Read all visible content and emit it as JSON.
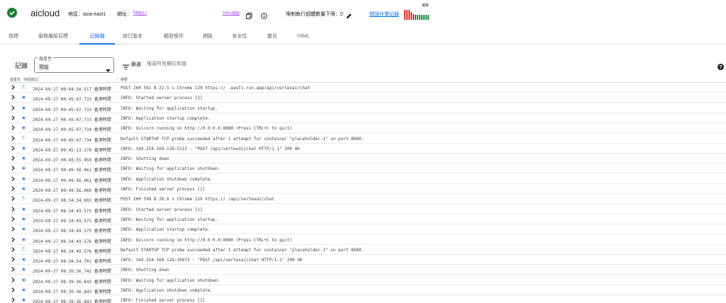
{
  "header": {
    "service_name": "aicloud",
    "region": "地區：asia-east1",
    "url_label": "網址：",
    "url": "https:/",
    "url_suffix": "run.app",
    "limit_label": "限制執行個體數量下限：0",
    "error_link": "錯誤作業記錄",
    "error_chart_label": "最新",
    "error_bars": [
      {
        "value": 1.0,
        "color": "#d93025"
      },
      {
        "value": 1.0,
        "color": "#d93025"
      },
      {
        "value": 1.0,
        "color": "#d93025"
      },
      {
        "value": 0.8,
        "color": "#d93025"
      },
      {
        "value": 0.6,
        "color": "#d93025"
      },
      {
        "value": 0.5,
        "color": "#1e8e3e"
      },
      {
        "value": 0.5,
        "color": "#1e8e3e"
      },
      {
        "value": 0.5,
        "color": "#1e8e3e"
      },
      {
        "value": 0.5,
        "color": "#1e8e3e"
      },
      {
        "value": 0.5,
        "color": "#1e8e3e"
      },
      {
        "value": 0.5,
        "color": "#1e8e3e"
      },
      {
        "value": 0.5,
        "color": "#1e8e3e"
      }
    ]
  },
  "tabs": [
    {
      "label": "指標",
      "active": false
    },
    {
      "label": "服務層級目標",
      "active": false
    },
    {
      "label": "記錄檔",
      "active": true
    },
    {
      "label": "修訂版本",
      "active": false
    },
    {
      "label": "觸發條件",
      "active": false
    },
    {
      "label": "網路",
      "active": false
    },
    {
      "label": "安全性",
      "active": false
    },
    {
      "label": "整合",
      "active": false
    },
    {
      "label": "YAML",
      "active": false
    }
  ],
  "toolbar": {
    "logs_title": "記錄",
    "severity_label": "嚴重性",
    "severity_value": "預設",
    "filter_label": "篩選",
    "filter_placeholder": "搜尋所有欄位和值"
  },
  "table": {
    "headers": [
      "嚴重性",
      "時間戳記",
      "摘要"
    ],
    "rows": [
      {
        "sev": "info",
        "time": "2024-09-27 00:44:50.517 香港時間",
        "summary": "POST  200  591 B  22.5 s  Chrome 129   https://                          -east1.run.app/api/vertexai/chat"
      },
      {
        "sev": "default",
        "time": "2024-09-27 00:45:07.733 香港時間",
        "summary": "INFO: Started server process [1]"
      },
      {
        "sev": "default",
        "time": "2024-09-27 00:45:07.733 香港時間",
        "summary": "INFO: Waiting for application startup."
      },
      {
        "sev": "default",
        "time": "2024-09-27 00:45:07.733 香港時間",
        "summary": "INFO: Application startup complete."
      },
      {
        "sev": "default",
        "time": "2024-09-27 00:45:07.734 香港時間",
        "summary": "INFO: Uvicorn running on http://0.0.0.0:8080 (Press CTRL+C to quit)"
      },
      {
        "sev": "info",
        "time": "2024-09-27 00:45:07.734 香港時間",
        "summary": "Default STARTUP TCP probe succeeded after 1 attempt for container \"placeholder-1\" on port 8080."
      },
      {
        "sev": "default",
        "time": "2024-09-27 00:45:13.270 香港時間",
        "summary": "INFO: 169.254.169.126:5113 - \"POST /api/vertexai/chat HTTP/1.1\" 200 OK"
      },
      {
        "sev": "default",
        "time": "2024-09-27 00:49:55.959 香港時間",
        "summary": "INFO: Shutting down"
      },
      {
        "sev": "default",
        "time": "2024-09-27 00:49:56.061 香港時間",
        "summary": "INFO: Waiting for application shutdown."
      },
      {
        "sev": "default",
        "time": "2024-09-27 00:49:56.061 香港時間",
        "summary": "INFO: Application shutdown complete."
      },
      {
        "sev": "default",
        "time": "2024-09-27 00:49:56.066 香港時間",
        "summary": "INFO: Finished server process [1]"
      },
      {
        "sev": "info",
        "time": "2024-09-27 08:34:34.003 香港時間",
        "summary": "POST  200  598 B  20.6 s  Chrome 129   https://                                        /api/vertexai/chat"
      },
      {
        "sev": "default",
        "time": "2024-09-27 08:34:49.575 香港時間",
        "summary": "INFO: Started server process [1]"
      },
      {
        "sev": "default",
        "time": "2024-09-27 08:34:49.575 香港時間",
        "summary": "INFO: Waiting for application startup."
      },
      {
        "sev": "default",
        "time": "2024-09-27 08:34:49.575 香港時間",
        "summary": "INFO: Application startup complete."
      },
      {
        "sev": "default",
        "time": "2024-09-27 08:34:49.576 香港時間",
        "summary": "INFO: Uvicorn running on http://0.0.0.0:8080 (Press CTRL+C to quit)"
      },
      {
        "sev": "info",
        "time": "2024-09-27 08:34:49.576 香港時間",
        "summary": "Default STARTUP TCP probe succeeded after 1 attempt for container \"placeholder-1\" on port 8080."
      },
      {
        "sev": "default",
        "time": "2024-09-27 08:34:54.702 香港時間",
        "summary": "INFO: 169.254.169.126:20873 - \"POST /api/vertexai/chat HTTP/1.1\" 200 OK"
      },
      {
        "sev": "default",
        "time": "2024-09-27 08:39:36.742 香港時間",
        "summary": "INFO: Shutting down"
      },
      {
        "sev": "default",
        "time": "2024-09-27 08:39:36.843 香港時間",
        "summary": "INFO: Waiting for application shutdown."
      },
      {
        "sev": "default",
        "time": "2024-09-27 08:39:36.843 香港時間",
        "summary": "INFO: Application shutdown complete."
      },
      {
        "sev": "default",
        "time": "2024-09-27 08:39:36.843 香港時間",
        "summary": "INFO: Finished server process [1]"
      }
    ]
  }
}
